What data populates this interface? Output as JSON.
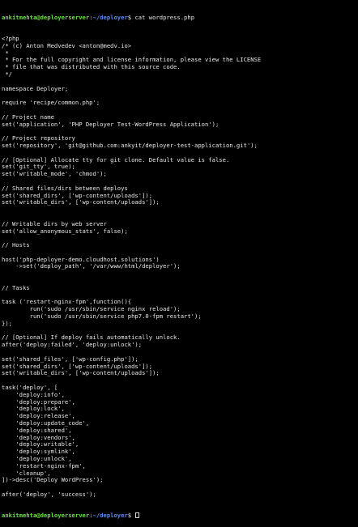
{
  "colors": {
    "background": "#000000",
    "text": "#e8e8e8",
    "user": "#6fdc4a",
    "path": "#5c8cf0"
  },
  "prompt": {
    "user_host": "ankitmehta@deployerserver",
    "sep": ":",
    "path": "~/deployer",
    "symbol": "$ "
  },
  "command": "cat wordpress.php",
  "lines": [
    "<?php",
    "/* (c) Anton Medvedev <anton@medv.io>",
    " *",
    " * For the full copyright and license information, please view the LICENSE",
    " * file that was distributed with this source code.",
    " */",
    "",
    "namespace Deployer;",
    "",
    "require 'recipe/common.php';",
    "",
    "// Project name",
    "set('application', 'PHP Deployer Test-WordPress Application');",
    "",
    "// Project repository",
    "set('repository', 'git@github.com:ankyit/deployer-test-application.git');",
    "",
    "// [Optional] Allocate tty for git clone. Default value is false.",
    "set('git_tty', true);",
    "set('writable_mode', 'chmod');",
    "",
    "// Shared files/dirs between deploys",
    "set('shared_dirs', ['wp-content/uploads']);",
    "set('writable_dirs', ['wp-content/uploads']);",
    "",
    "",
    "// Writable dirs by web server",
    "set('allow_anonymous_stats', false);",
    "",
    "// Hosts",
    "",
    "host('php-deployer-demo.cloudhost.solutions')",
    "    ->set('deploy_path', '/var/www/html/deployer');",
    "",
    "",
    "// Tasks",
    "",
    "task ('restart-nginx-fpm',function(){",
    "        run('sudo /usr/sbin/service nginx reload');",
    "        run('sudo /usr/sbin/service php7.0-fpm restart');",
    "});",
    "",
    "// [Optional] If deploy fails automatically unlock.",
    "after('deploy:failed', 'deploy:unlock');",
    "",
    "set('shared_files', ['wp-config.php']);",
    "set('shared_dirs', ['wp-content/uploads']);",
    "set('writable_dirs', ['wp-content/uploads']);",
    "",
    "task('deploy', [",
    "    'deploy:info',",
    "    'deploy:prepare',",
    "    'deploy:lock',",
    "    'deploy:release',",
    "    'deploy:update_code',",
    "    'deploy:shared',",
    "    'deploy:vendors',",
    "    'deploy:writable',",
    "    'deploy:symlink',",
    "    'deploy:unlock',",
    "    'restart-nginx-fpm',",
    "    'cleanup',",
    "])->desc('Deploy WordPress');",
    "",
    "after('deploy', 'success');"
  ]
}
